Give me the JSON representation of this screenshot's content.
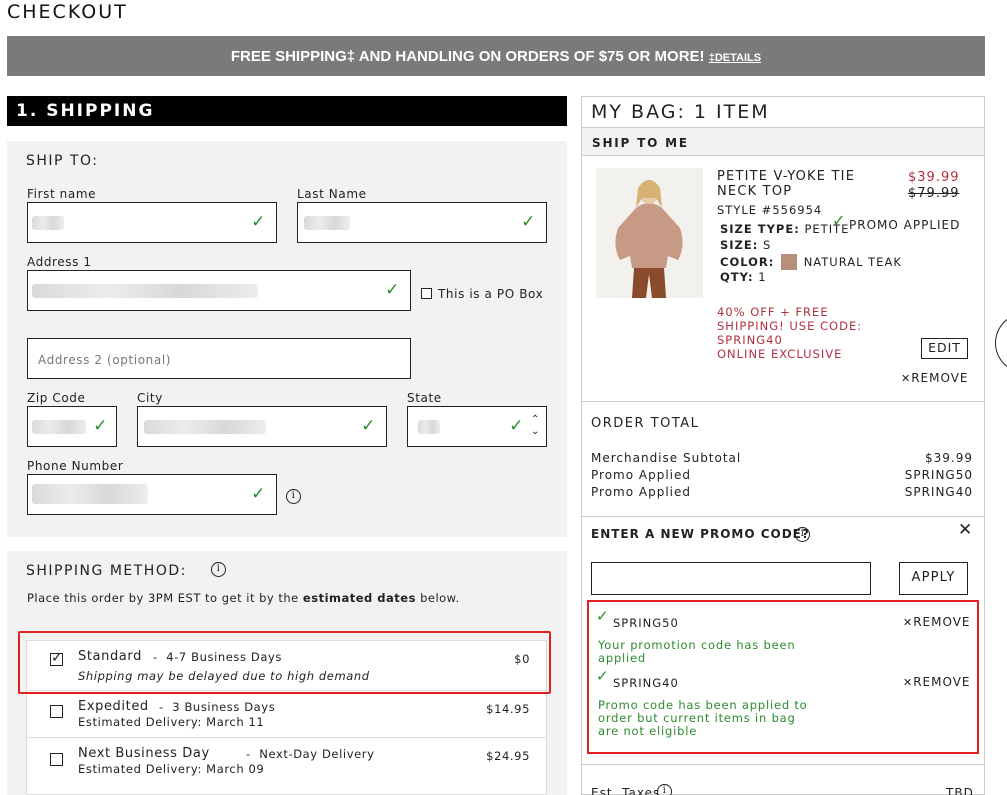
{
  "page": {
    "title": "CHECKOUT"
  },
  "banner": {
    "text": "FREE SHIPPING‡ AND HANDLING ON ORDERS OF $75 OR MORE!",
    "details_link": "‡DETAILS"
  },
  "shipping": {
    "header": "1. SHIPPING",
    "ship_to_title": "SHIP TO:",
    "first_name_label": "First name",
    "last_name_label": "Last Name",
    "address1_label": "Address 1",
    "po_box_label": "This is a PO Box",
    "address2_placeholder": "Address 2 (optional)",
    "zip_label": "Zip Code",
    "city_label": "City",
    "state_label": "State",
    "phone_label": "Phone Number"
  },
  "shipping_method": {
    "title": "SHIPPING METHOD:",
    "note_prefix": "Place this order by 3PM EST to get it by the ",
    "note_bold": "estimated dates",
    "note_suffix": " below.",
    "options": [
      {
        "name": "Standard",
        "detail": "4-7 Business Days",
        "sub": "Shipping may be delayed due to high demand",
        "price": "$0"
      },
      {
        "name": "Expedited",
        "detail": "3 Business Days",
        "sub": "Estimated Delivery: March 11",
        "price": "$14.95"
      },
      {
        "name": "Next Business Day",
        "detail": "Next-Day Delivery",
        "sub": "Estimated Delivery: March 09",
        "price": "$24.95"
      }
    ]
  },
  "bag": {
    "title": "MY BAG: 1 ITEM",
    "ship_to_me": "SHIP TO ME",
    "item": {
      "name_line1": "PETITE V-YOKE TIE",
      "name_line2": "NECK TOP",
      "style": "STYLE #556954",
      "price_sale": "$39.99",
      "price_orig": "$79.99",
      "promo_applied": "PROMO APPLIED",
      "size_type_label": "SIZE TYPE:",
      "size_type_value": "PETITE",
      "size_label": "SIZE:",
      "size_value": "S",
      "color_label": "COLOR:",
      "color_value": "NATURAL TEAK",
      "qty_label": "QTY:",
      "qty_value": "1",
      "promo_msg_1": "40% OFF + FREE",
      "promo_msg_2": "SHIPPING! USE CODE:",
      "promo_msg_3": "SPRING40",
      "promo_msg_4": "ONLINE EXCLUSIVE",
      "edit": "EDIT",
      "remove": "REMOVE"
    },
    "order_total": {
      "title": "ORDER TOTAL",
      "rows": [
        {
          "label": "Merchandise Subtotal",
          "value": "$39.99"
        },
        {
          "label": "Promo Applied",
          "value": "SPRING50"
        },
        {
          "label": "Promo Applied",
          "value": "SPRING40"
        }
      ]
    },
    "promo": {
      "title": "ENTER A NEW PROMO CODE?",
      "apply": "APPLY",
      "codes": [
        {
          "code": "SPRING50",
          "remove": "REMOVE",
          "msg_1": "Your promotion code has been",
          "msg_2": "applied",
          "msg_3": ""
        },
        {
          "code": "SPRING40",
          "remove": "REMOVE",
          "msg_1": "Promo code has been applied to",
          "msg_2": "order but current items in bag",
          "msg_3": "are not eligible"
        }
      ]
    },
    "est_tax_label": "Est. Taxes",
    "est_tax_value": "TBD"
  },
  "colors": {
    "banner_bg": "#7a7a7a",
    "accent_red": "#b03040",
    "success_green": "#2e8b2e",
    "highlight_border": "#e02020",
    "swatch": "#b8907a"
  }
}
